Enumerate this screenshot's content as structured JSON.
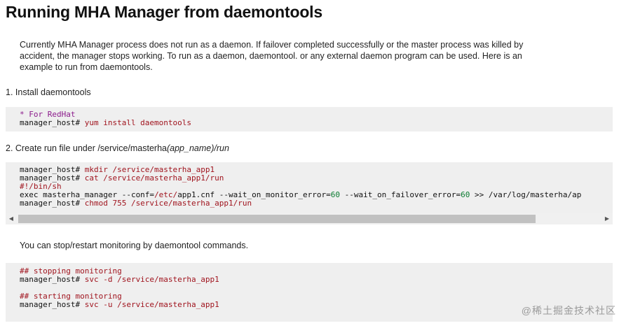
{
  "title": "Running MHA Manager from daemontools",
  "intro": "Currently MHA Manager process does not run as a daemon. If failover completed successfully or the master process was killed by accident, the manager stops working. To run as a daemon, daemontool. or any external daemon program can be used. Here is an example to run from daemontools.",
  "step1": "1. Install daemontools",
  "block1": {
    "comment": "* For RedHat",
    "prompt": "manager_host#",
    "cmd": " yum install daemontools"
  },
  "step2": {
    "prefix": "2. Create run file under /service/masterha",
    "italic": "(app_name)",
    "suffix": "/run"
  },
  "block2": {
    "l1_prompt": "manager_host#",
    "l1_cmd": " mkdir /service/masterha_app1",
    "l2_prompt": "manager_host#",
    "l2_cmd": " cat /service/masterha_app1/run",
    "l3": "#!/bin/sh",
    "l4_a": "exec masterha_manager --conf=",
    "l4_b": "/etc/",
    "l4_c": "app1.cnf --wait_on_monitor_error=",
    "l4_d": "60",
    "l4_e": " --wait_on_failover_error=",
    "l4_f": "60",
    "l4_g": " >> /var/",
    "l4_h": "log/masterha/ap",
    "l5_prompt": "manager_host#",
    "l5_cmd": " chmod 755 /service/masterha_app1/run"
  },
  "para2": "You can stop/restart monitoring by daemontool commands.",
  "block3": {
    "c1": "## stopping monitoring",
    "l1_prompt": "manager_host#",
    "l1_cmd": " svc -d /service/masterha_app1",
    "c2": "## starting monitoring",
    "l2_prompt": "manager_host#",
    "l2_cmd": " svc -u /service/masterha_app1"
  },
  "scrollbar": {
    "left_arrow": "◀",
    "right_arrow": "▶",
    "position": 0
  },
  "watermark": "@稀土掘金技术社区"
}
